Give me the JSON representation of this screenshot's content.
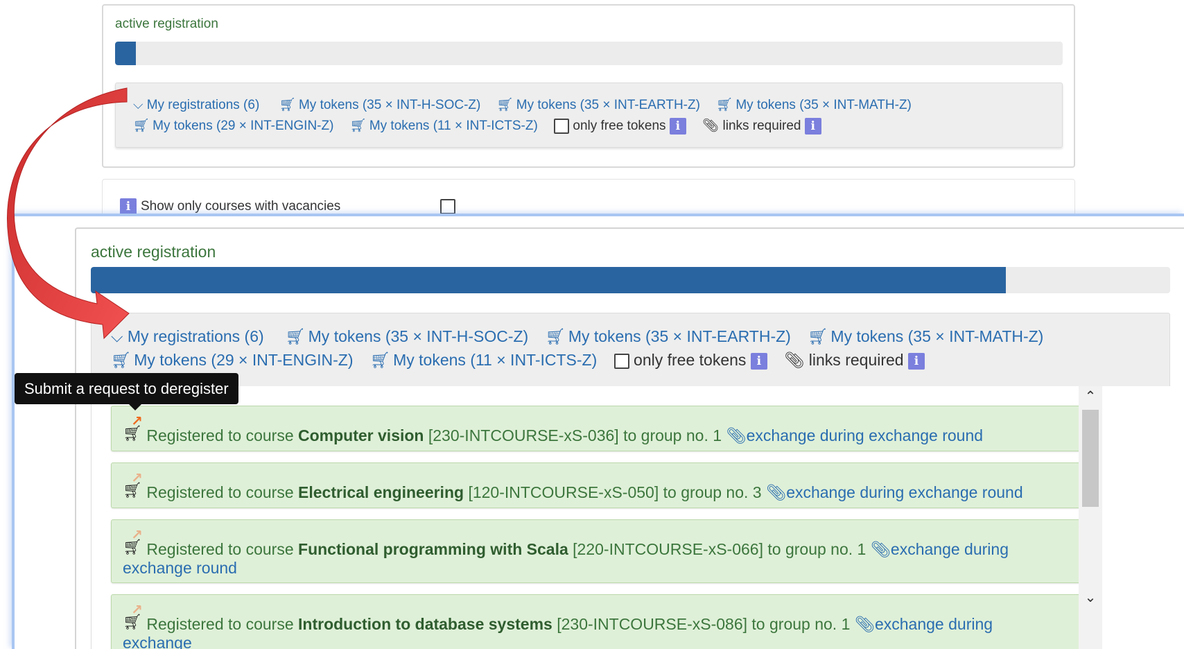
{
  "active_label": "active registration",
  "progress": {
    "top_fraction": 0.022,
    "zoom_fraction": 0.848
  },
  "tokens": {
    "my_registrations": "My registrations (6)",
    "items": [
      "My tokens (35 × INT-H-SOC-Z)",
      "My tokens (35 × INT-EARTH-Z)",
      "My tokens (35 × INT-MATH-Z)",
      "My tokens (29 × INT-ENGIN-Z)",
      "My tokens (11 × INT-ICTS-Z)"
    ],
    "only_free_label": "only free tokens",
    "links_required_label": "links required"
  },
  "vacancies_label": "Show only courses with vacancies",
  "tooltip": "Submit a request to deregister",
  "registrations": [
    {
      "prefix": "Registered to course",
      "course": "Computer vision",
      "code": "[230-INTCOURSE-xS-036]",
      "group": "to group no. 1",
      "link": "exchange during exchange round"
    },
    {
      "prefix": "Registered to course",
      "course": "Electrical engineering",
      "code": "[120-INTCOURSE-xS-050]",
      "group": "to group no. 3",
      "link": "exchange during exchange round"
    },
    {
      "prefix": "Registered to course",
      "course": "Functional programming with Scala",
      "code": "[220-INTCOURSE-xS-066]",
      "group": "to group no. 1",
      "link": "exchange during exchange round"
    },
    {
      "prefix": "Registered to course",
      "course": "Introduction to database systems",
      "code": "[230-INTCOURSE-xS-086]",
      "group": "to group no. 1",
      "link": "exchange during exchange"
    }
  ],
  "colors": {
    "progress": "#2a64a0",
    "success_bg": "#dff0d8",
    "success_text": "#3c763d",
    "link": "#2a6db0",
    "info_badge": "#7b7fdd",
    "arrow": "#e84545"
  },
  "icons": {
    "chevron": "chevron-down-icon",
    "cart": "shopping-cart-icon",
    "info": "info-icon",
    "paperclip": "paperclip-icon",
    "deregister": "deregister-cart-icon"
  }
}
